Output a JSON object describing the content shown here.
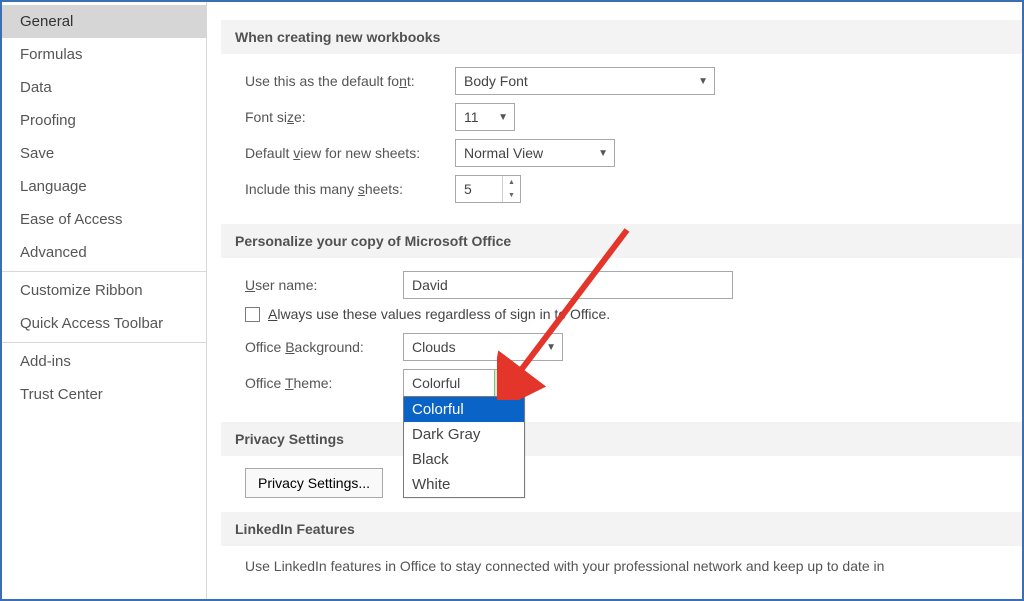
{
  "sidebar": {
    "items": [
      {
        "label": "General",
        "active": true
      },
      {
        "label": "Formulas"
      },
      {
        "label": "Data"
      },
      {
        "label": "Proofing"
      },
      {
        "label": "Save"
      },
      {
        "label": "Language"
      },
      {
        "label": "Ease of Access"
      },
      {
        "label": "Advanced"
      }
    ],
    "group2": [
      {
        "label": "Customize Ribbon"
      },
      {
        "label": "Quick Access Toolbar"
      }
    ],
    "group3": [
      {
        "label": "Add-ins"
      },
      {
        "label": "Trust Center"
      }
    ]
  },
  "sections": {
    "newwb": {
      "heading": "When creating new workbooks",
      "font_label": "Use this as the default font:",
      "font_value": "Body Font",
      "size_label": "Font size:",
      "size_value": "11",
      "view_label": "Default view for new sheets:",
      "view_value": "Normal View",
      "sheets_label": "Include this many sheets:",
      "sheets_value": "5"
    },
    "personalize": {
      "heading": "Personalize your copy of Microsoft Office",
      "username_label": "User name:",
      "username_value": "David",
      "always_label": "Always use these values regardless of sign in to Office.",
      "bg_label": "Office Background:",
      "bg_value": "Clouds",
      "theme_label": "Office Theme:",
      "theme_value": "Colorful",
      "theme_options": [
        "Colorful",
        "Dark Gray",
        "Black",
        "White"
      ]
    },
    "privacy": {
      "heading": "Privacy Settings",
      "button": "Privacy Settings..."
    },
    "linkedin": {
      "heading": "LinkedIn Features",
      "text": "Use LinkedIn features in Office to stay connected with your professional network and keep up to date in"
    }
  }
}
